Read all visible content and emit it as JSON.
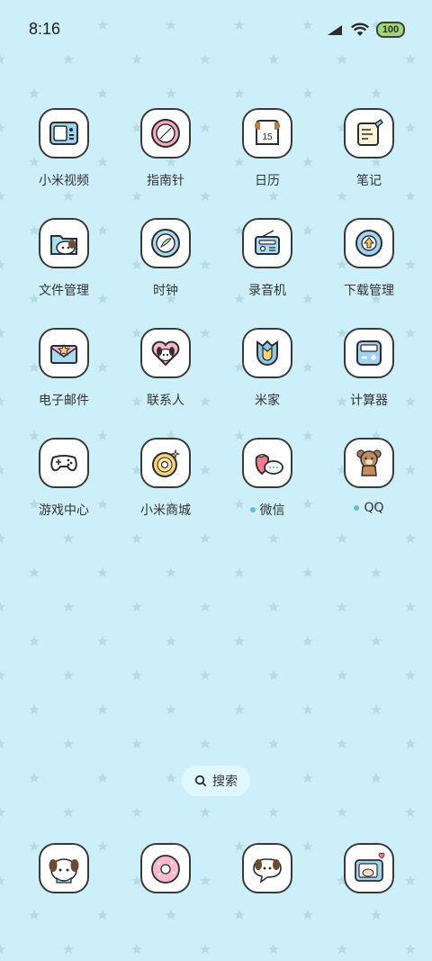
{
  "status_bar": {
    "time": "8:16",
    "battery": "100"
  },
  "apps": [
    {
      "label": "小米视频",
      "icon": "tv-icon"
    },
    {
      "label": "指南针",
      "icon": "compass-icon"
    },
    {
      "label": "日历",
      "icon": "calendar-icon",
      "badge": "15"
    },
    {
      "label": "笔记",
      "icon": "notes-icon"
    },
    {
      "label": "文件管理",
      "icon": "folder-dog-icon"
    },
    {
      "label": "时钟",
      "icon": "clock-icon"
    },
    {
      "label": "录音机",
      "icon": "radio-icon"
    },
    {
      "label": "下载管理",
      "icon": "download-icon"
    },
    {
      "label": "电子邮件",
      "icon": "mail-icon"
    },
    {
      "label": "联系人",
      "icon": "heart-dog-icon"
    },
    {
      "label": "米家",
      "icon": "tulip-icon"
    },
    {
      "label": "计算器",
      "icon": "calculator-icon"
    },
    {
      "label": "游戏中心",
      "icon": "gamepad-icon"
    },
    {
      "label": "小米商城",
      "icon": "donut-icon"
    },
    {
      "label": "微信",
      "icon": "strawberry-chat-icon"
    },
    {
      "label": "QQ",
      "icon": "bear-icon"
    }
  ],
  "search": {
    "label": "搜索"
  },
  "dock": [
    {
      "icon": "dog-phone-icon"
    },
    {
      "icon": "pink-donut-icon"
    },
    {
      "icon": "dog-chat-icon"
    },
    {
      "icon": "camera-icon"
    }
  ],
  "colors": {
    "background": "#cdeffa",
    "star": "#b7dbe6",
    "icon_border": "#3a3a3a",
    "unread_dot": "#5bc1d8"
  }
}
